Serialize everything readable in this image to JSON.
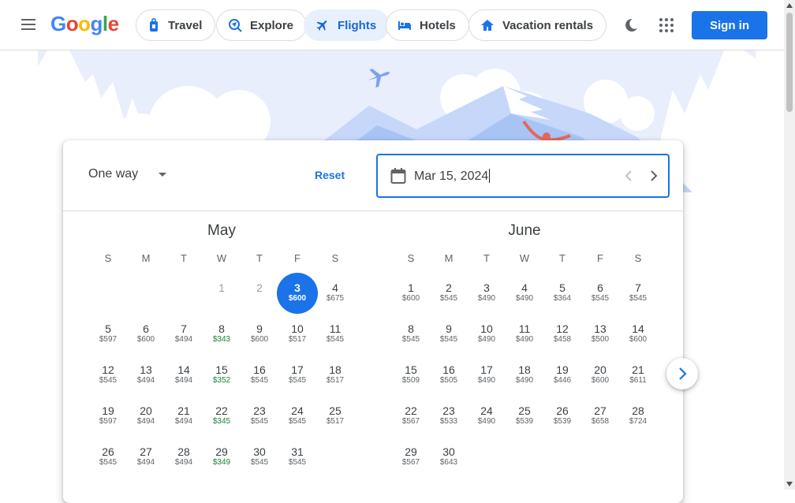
{
  "header": {
    "logo_parts": [
      "G",
      "o",
      "o",
      "g",
      "l",
      "e"
    ],
    "nav": [
      {
        "label": "Travel",
        "icon": "travel-bag-icon",
        "active": false
      },
      {
        "label": "Explore",
        "icon": "explore-globe-icon",
        "active": false
      },
      {
        "label": "Flights",
        "icon": "airplane-icon",
        "active": true
      },
      {
        "label": "Hotels",
        "icon": "bed-icon",
        "active": false
      },
      {
        "label": "Vacation rentals",
        "icon": "house-icon",
        "active": false
      }
    ],
    "sign_in": "Sign in"
  },
  "colors": {
    "accent": "#1a73e8",
    "low_price": "#188038"
  },
  "date_panel": {
    "trip_type": "One way",
    "reset": "Reset",
    "date_value": "Mar 15, 2024"
  },
  "months": [
    {
      "name": "May",
      "dow": [
        "S",
        "M",
        "T",
        "W",
        "T",
        "F",
        "S"
      ],
      "lead_blanks": 3,
      "days": [
        {
          "d": "1",
          "p": "",
          "past": true
        },
        {
          "d": "2",
          "p": "",
          "past": true
        },
        {
          "d": "3",
          "p": "$600",
          "selected": true
        },
        {
          "d": "4",
          "p": "$675"
        },
        {
          "d": "5",
          "p": "$597"
        },
        {
          "d": "6",
          "p": "$600"
        },
        {
          "d": "7",
          "p": "$494"
        },
        {
          "d": "8",
          "p": "$343",
          "low": true
        },
        {
          "d": "9",
          "p": "$600"
        },
        {
          "d": "10",
          "p": "$517"
        },
        {
          "d": "11",
          "p": "$545"
        },
        {
          "d": "12",
          "p": "$545"
        },
        {
          "d": "13",
          "p": "$494"
        },
        {
          "d": "14",
          "p": "$494"
        },
        {
          "d": "15",
          "p": "$352",
          "low": true
        },
        {
          "d": "16",
          "p": "$545"
        },
        {
          "d": "17",
          "p": "$545"
        },
        {
          "d": "18",
          "p": "$517"
        },
        {
          "d": "19",
          "p": "$597"
        },
        {
          "d": "20",
          "p": "$494"
        },
        {
          "d": "21",
          "p": "$494"
        },
        {
          "d": "22",
          "p": "$345",
          "low": true
        },
        {
          "d": "23",
          "p": "$545"
        },
        {
          "d": "24",
          "p": "$545"
        },
        {
          "d": "25",
          "p": "$517"
        },
        {
          "d": "26",
          "p": "$545"
        },
        {
          "d": "27",
          "p": "$494"
        },
        {
          "d": "28",
          "p": "$494"
        },
        {
          "d": "29",
          "p": "$349",
          "low": true
        },
        {
          "d": "30",
          "p": "$545"
        },
        {
          "d": "31",
          "p": "$545"
        }
      ]
    },
    {
      "name": "June",
      "dow": [
        "S",
        "M",
        "T",
        "W",
        "T",
        "F",
        "S"
      ],
      "lead_blanks": 0,
      "days": [
        {
          "d": "1",
          "p": "$600"
        },
        {
          "d": "2",
          "p": "$545"
        },
        {
          "d": "3",
          "p": "$490"
        },
        {
          "d": "4",
          "p": "$490"
        },
        {
          "d": "5",
          "p": "$364"
        },
        {
          "d": "6",
          "p": "$545"
        },
        {
          "d": "7",
          "p": "$545"
        },
        {
          "d": "8",
          "p": "$545"
        },
        {
          "d": "9",
          "p": "$545"
        },
        {
          "d": "10",
          "p": "$490"
        },
        {
          "d": "11",
          "p": "$490"
        },
        {
          "d": "12",
          "p": "$458"
        },
        {
          "d": "13",
          "p": "$500"
        },
        {
          "d": "14",
          "p": "$600"
        },
        {
          "d": "15",
          "p": "$509"
        },
        {
          "d": "16",
          "p": "$505"
        },
        {
          "d": "17",
          "p": "$490"
        },
        {
          "d": "18",
          "p": "$490"
        },
        {
          "d": "19",
          "p": "$446"
        },
        {
          "d": "20",
          "p": "$600"
        },
        {
          "d": "21",
          "p": "$611"
        },
        {
          "d": "22",
          "p": "$567"
        },
        {
          "d": "23",
          "p": "$533"
        },
        {
          "d": "24",
          "p": "$490"
        },
        {
          "d": "25",
          "p": "$539"
        },
        {
          "d": "26",
          "p": "$539"
        },
        {
          "d": "27",
          "p": "$658"
        },
        {
          "d": "28",
          "p": "$724"
        },
        {
          "d": "29",
          "p": "$567"
        },
        {
          "d": "30",
          "p": "$643"
        }
      ]
    }
  ]
}
